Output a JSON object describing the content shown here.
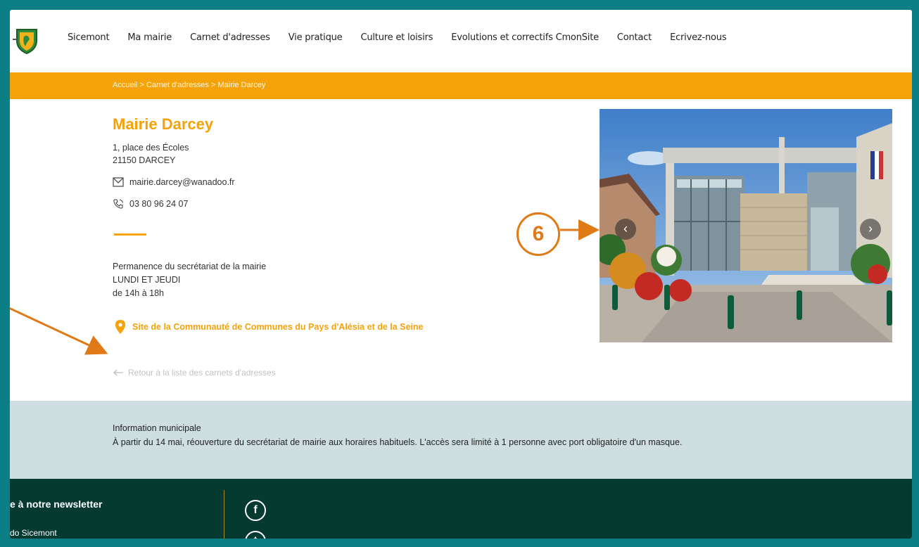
{
  "nav": {
    "items": [
      "Sicemont",
      "Ma mairie",
      "Carnet d'adresses",
      "Vie pratique",
      "Culture et loisirs",
      "Evolutions et correctifs CmonSite",
      "Contact",
      "Ecrivez-nous"
    ]
  },
  "breadcrumb": {
    "home": "Accueil",
    "sep": " > ",
    "section": "Carnet d'adresses",
    "current": "Mairie Darcey"
  },
  "entry": {
    "title": "Mairie Darcey",
    "address_line1": "1, place des Écoles",
    "address_line2": "21150 DARCEY",
    "email": "mairie.darcey@wanadoo.fr",
    "phone": "03 80 96 24 07",
    "hours_label": "Permanence du secrétariat de la mairie",
    "hours_days": "LUNDI ET JEUDI",
    "hours_time": "de 14h à 18h",
    "site_link": "Site de la Communauté de Communes du Pays d'Alésia et de la Seine",
    "back_link": "Retour à la liste des carnets d'adresses"
  },
  "carousel": {
    "prev": "‹",
    "next": "›"
  },
  "annotation": {
    "number": "6"
  },
  "info": {
    "title": "Information municipale",
    "text": "À partir du 14 mai, réouverture du secrétariat de mairie aux horaires habituels. L'accès sera limité à 1 personne avec port obligatoire d'un masque."
  },
  "footer": {
    "newsletter_title": "e à notre newsletter",
    "newsletter_sub": "do Sicemont",
    "facebook": "f",
    "twitter": "t"
  },
  "colors": {
    "accent": "#f5a20b",
    "annotation": "#e07a17",
    "footer": "#043a30",
    "info_band": "#cfdfe1",
    "frame": "#0b7e86"
  }
}
